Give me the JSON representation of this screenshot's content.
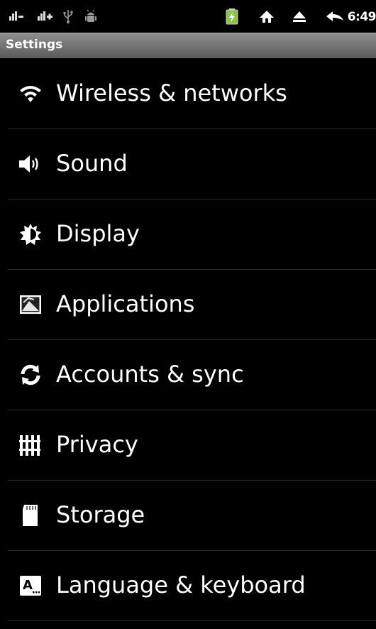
{
  "status_bar": {
    "time": "6:49",
    "icons": [
      "signal-down-icon",
      "signal-up-icon",
      "usb-icon",
      "debug-icon",
      "battery-charging-icon",
      "home-icon",
      "eject-icon",
      "back-icon"
    ]
  },
  "title_bar": {
    "title": "Settings"
  },
  "settings": {
    "items": [
      {
        "label": "Wireless & networks",
        "icon": "wifi-icon"
      },
      {
        "label": "Sound",
        "icon": "speaker-icon"
      },
      {
        "label": "Display",
        "icon": "brightness-icon"
      },
      {
        "label": "Applications",
        "icon": "applications-icon"
      },
      {
        "label": "Accounts & sync",
        "icon": "sync-icon"
      },
      {
        "label": "Privacy",
        "icon": "privacy-fence-icon"
      },
      {
        "label": "Storage",
        "icon": "sd-card-icon"
      },
      {
        "label": "Language & keyboard",
        "icon": "keyboard-icon"
      }
    ]
  },
  "colors": {
    "background": "#000000",
    "text": "#ffffff",
    "titlebar": "#707070",
    "divider": "#2b2b2b"
  }
}
